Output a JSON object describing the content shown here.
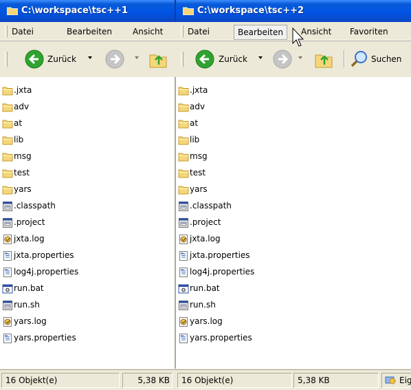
{
  "windows": [
    {
      "title": "C:\\workspace\\tsc++1",
      "menu": [
        "Datei",
        "Bearbeiten",
        "Ansicht"
      ],
      "toolbar": {
        "back_label": "Zurück"
      },
      "files": [
        {
          "name": ".jxta",
          "icon": "folder-icon"
        },
        {
          "name": "adv",
          "icon": "folder-icon"
        },
        {
          "name": "at",
          "icon": "folder-icon"
        },
        {
          "name": "lib",
          "icon": "folder-icon"
        },
        {
          "name": "msg",
          "icon": "folder-icon"
        },
        {
          "name": "test",
          "icon": "folder-icon"
        },
        {
          "name": "yars",
          "icon": "folder-icon"
        },
        {
          "name": ".classpath",
          "icon": "generic-file-icon"
        },
        {
          "name": ".project",
          "icon": "generic-file-icon"
        },
        {
          "name": "jxta.log",
          "icon": "log-file-icon"
        },
        {
          "name": "jxta.properties",
          "icon": "properties-file-icon"
        },
        {
          "name": "log4j.properties",
          "icon": "properties-file-icon"
        },
        {
          "name": "run.bat",
          "icon": "batch-file-icon"
        },
        {
          "name": "run.sh",
          "icon": "generic-file-icon"
        },
        {
          "name": "yars.log",
          "icon": "log-file-icon"
        },
        {
          "name": "yars.properties",
          "icon": "properties-file-icon"
        }
      ],
      "status": {
        "count": "16 Objekt(e)",
        "size": "5,38 KB"
      }
    },
    {
      "title": "C:\\workspace\\tsc++2",
      "menu": [
        "Datei",
        "Bearbeiten",
        "Ansicht",
        "Favoriten"
      ],
      "hovered_menu": "Bearbeiten",
      "toolbar": {
        "back_label": "Zurück",
        "search_label": "Suchen"
      },
      "files": [
        {
          "name": ".jxta",
          "icon": "folder-icon"
        },
        {
          "name": "adv",
          "icon": "folder-icon"
        },
        {
          "name": "at",
          "icon": "folder-icon"
        },
        {
          "name": "lib",
          "icon": "folder-icon"
        },
        {
          "name": "msg",
          "icon": "folder-icon"
        },
        {
          "name": "test",
          "icon": "folder-icon"
        },
        {
          "name": "yars",
          "icon": "folder-icon"
        },
        {
          "name": ".classpath",
          "icon": "generic-file-icon"
        },
        {
          "name": ".project",
          "icon": "generic-file-icon"
        },
        {
          "name": "jxta.log",
          "icon": "log-file-icon"
        },
        {
          "name": "jxta.properties",
          "icon": "properties-file-icon"
        },
        {
          "name": "log4j.properties",
          "icon": "properties-file-icon"
        },
        {
          "name": "run.bat",
          "icon": "batch-file-icon"
        },
        {
          "name": "run.sh",
          "icon": "generic-file-icon"
        },
        {
          "name": "yars.log",
          "icon": "log-file-icon"
        },
        {
          "name": "yars.properties",
          "icon": "properties-file-icon"
        }
      ],
      "status": {
        "count": "16 Objekt(e)",
        "size": "5,38 KB",
        "zone": "Eige"
      }
    }
  ],
  "colors": {
    "title_bar": "#0054e3",
    "chrome": "#ece9d8",
    "folder": "#f5d77a",
    "back_arrow": "#2fa32f",
    "forward_disabled": "#c5c5c5"
  }
}
